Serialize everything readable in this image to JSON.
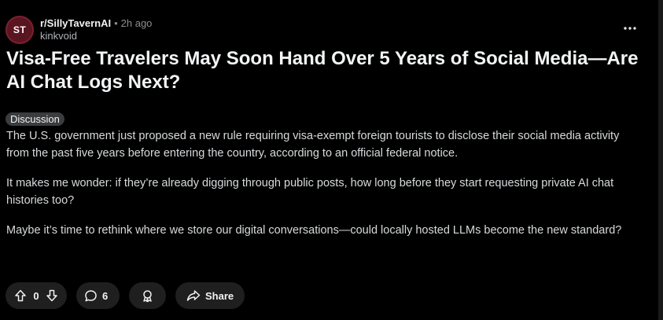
{
  "post": {
    "subreddit": "r/SillyTavernAI",
    "separator": "•",
    "time": "2h ago",
    "author": "kinkvoid",
    "avatar_text": "ST",
    "title": "Visa-Free Travelers May Soon Hand Over 5 Years of Social Media—Are AI Chat Logs Next?",
    "flair": "Discussion",
    "paragraphs": [
      "The U.S. government just proposed a new rule requiring visa-exempt foreign tourists to disclose their social media activity from the past five years before entering the country, according to an official federal notice.",
      "It makes me wonder: if they’re already digging through public posts, how long before they start requesting private AI chat histories too?",
      "Maybe it’s time to rethink where we store our digital conversations—could locally hosted LLMs become the new standard?"
    ]
  },
  "actions": {
    "vote_count": "0",
    "comment_count": "6",
    "share_label": "Share"
  },
  "icons": {
    "more": "more-options-icon",
    "upvote": "upvote-icon",
    "downvote": "downvote-icon",
    "comment": "comment-icon",
    "award": "award-icon",
    "share": "share-icon"
  },
  "colors": {
    "background": "#000000",
    "avatar_bg": "#5a1520",
    "pill_bg": "#1f1f1f",
    "flair_bg": "#3a3c3e",
    "text": "#d7dadc",
    "muted": "#8a8d90"
  }
}
